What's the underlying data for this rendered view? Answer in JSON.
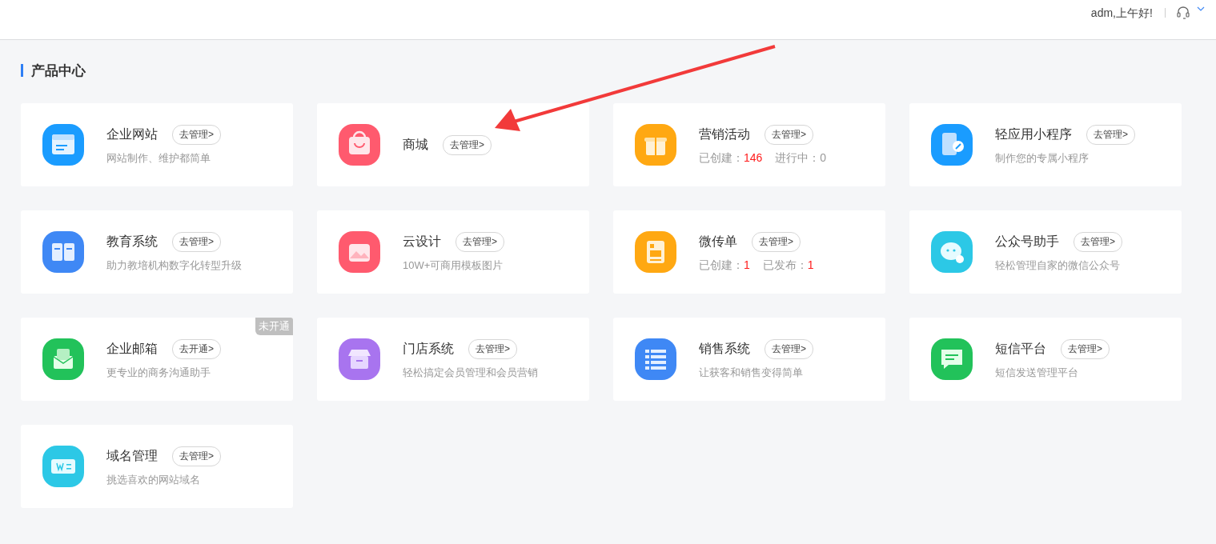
{
  "header": {
    "greeting": "adm,上午好!",
    "divider": "|"
  },
  "section": {
    "title": "产品中心"
  },
  "cards": [
    {
      "kind": "desc",
      "title": "企业网站",
      "action": "去管理>",
      "desc": "网站制作、维护都简单",
      "color": "#1a9cff"
    },
    {
      "kind": "none",
      "title": "商城",
      "action": "去管理>",
      "color": "#ff5a6e"
    },
    {
      "kind": "stats",
      "title": "营销活动",
      "action": "去管理>",
      "stats": [
        {
          "label": "已创建：",
          "value": "146",
          "highlight": true
        },
        {
          "label": "进行中：",
          "value": "0",
          "highlight": false
        }
      ],
      "color": "#ffa812"
    },
    {
      "kind": "desc",
      "title": "轻应用小程序",
      "action": "去管理>",
      "desc": "制作您的专属小程序",
      "color": "#1a9cff"
    },
    {
      "kind": "desc",
      "title": "教育系统",
      "action": "去管理>",
      "desc": "助力教培机构数字化转型升级",
      "color": "#3f88f5"
    },
    {
      "kind": "desc",
      "title": "云设计",
      "action": "去管理>",
      "desc": "10W+可商用模板图片",
      "color": "#ff5a6e"
    },
    {
      "kind": "stats",
      "title": "微传单",
      "action": "去管理>",
      "stats": [
        {
          "label": "已创建：",
          "value": "1",
          "highlight": true
        },
        {
          "label": "已发布：",
          "value": "1",
          "highlight": true
        }
      ],
      "color": "#ffa812"
    },
    {
      "kind": "desc",
      "title": "公众号助手",
      "action": "去管理>",
      "desc": "轻松管理自家的微信公众号",
      "color": "#2cc8e6"
    },
    {
      "kind": "desc",
      "title": "企业邮箱",
      "action": "去开通>",
      "desc": "更专业的商务沟通助手",
      "badge": "未开通",
      "color": "#22c25a"
    },
    {
      "kind": "desc",
      "title": "门店系统",
      "action": "去管理>",
      "desc": "轻松搞定会员管理和会员营销",
      "color": "#a874ef"
    },
    {
      "kind": "desc",
      "title": "销售系统",
      "action": "去管理>",
      "desc": "让获客和销售变得简单",
      "color": "#3f88f5"
    },
    {
      "kind": "desc",
      "title": "短信平台",
      "action": "去管理>",
      "desc": "短信发送管理平台",
      "color": "#22c25a"
    },
    {
      "kind": "desc",
      "title": "域名管理",
      "action": "去管理>",
      "desc": "挑选喜欢的网站域名",
      "color": "#2cc8e6"
    }
  ]
}
